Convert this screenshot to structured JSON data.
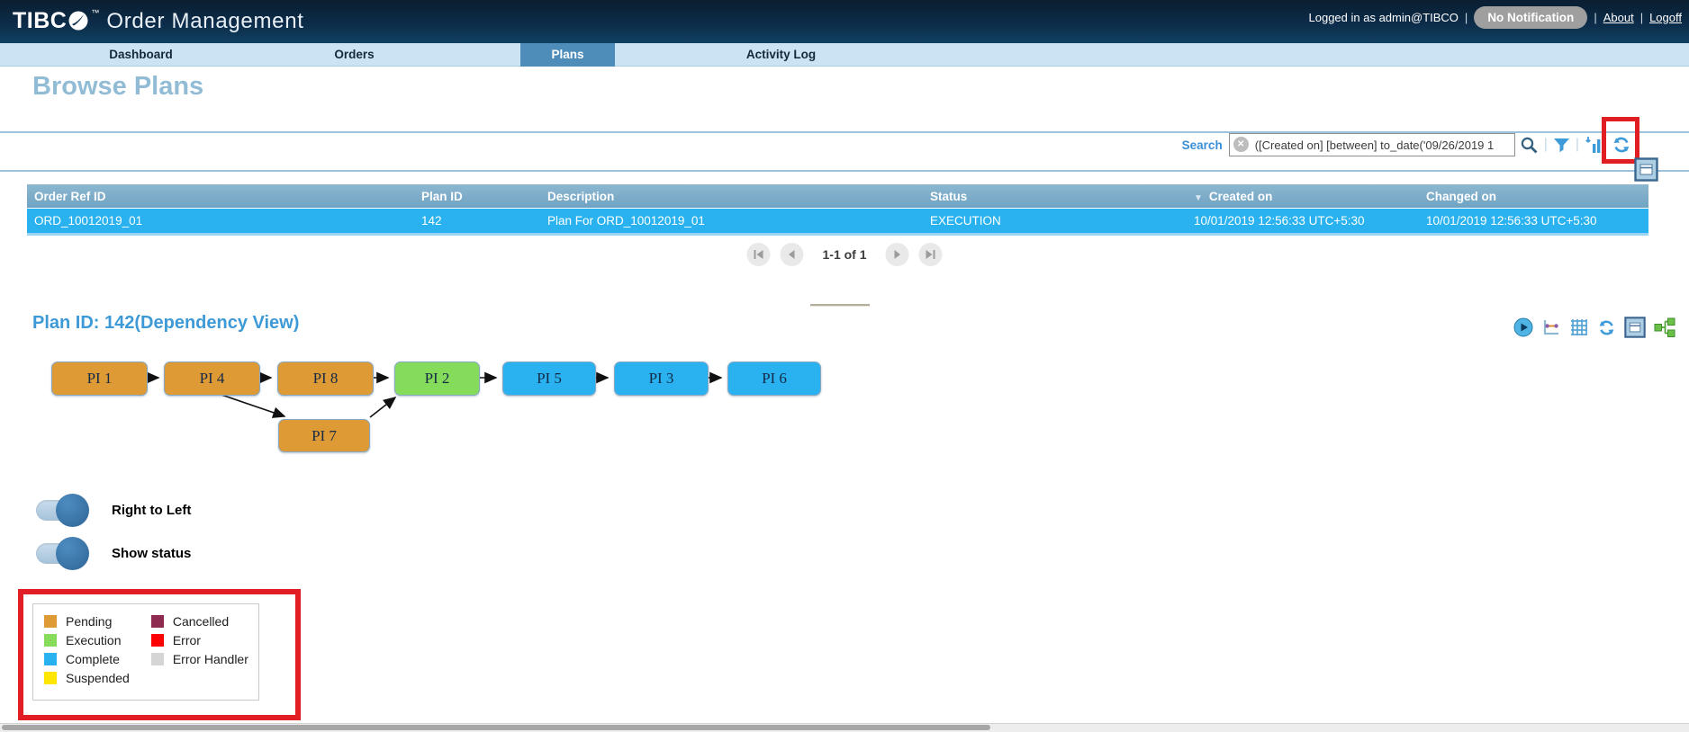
{
  "header": {
    "brand_tibc": "TIBC",
    "brand_tm": "™",
    "brand_product": "Order Management",
    "logged_in_text": "Logged in as admin@TIBCO",
    "divider": "|",
    "notification_label": "No Notification",
    "about_label": "About",
    "logoff_label": "Logoff"
  },
  "nav": {
    "active_tab": "Plans",
    "tabs": [
      {
        "label": "Dashboard"
      },
      {
        "label": "Orders"
      },
      {
        "label": "Plans"
      },
      {
        "label": "Activity Log"
      }
    ]
  },
  "page_title": "Browse Plans",
  "search": {
    "label": "Search",
    "value": "([Created on] [between] to_date('09/26/2019 1",
    "icons": [
      "clear-icon",
      "search-icon",
      "filter-icon",
      "export-report-icon",
      "refresh-icon"
    ]
  },
  "table": {
    "columns": [
      "Order Ref ID",
      "Plan ID",
      "Description",
      "Status",
      "Created on",
      "Changed on"
    ],
    "sorted_column": "Created on",
    "sort_direction": "desc",
    "rows": [
      {
        "order_ref": "ORD_10012019_01",
        "plan_id": "142",
        "description": "Plan For ORD_10012019_01",
        "status": "EXECUTION",
        "created_on": "10/01/2019 12:56:33 UTC+5:30",
        "changed_on": "10/01/2019 12:56:33 UTC+5:30"
      }
    ]
  },
  "pagination": {
    "status": "1-1 of 1"
  },
  "plan_view": {
    "title": "Plan ID: 142(Dependency View)",
    "toolbar_icons": [
      "play-icon",
      "timeline-icon",
      "grid-icon",
      "refresh-icon",
      "panel-icon",
      "tree-view-icon"
    ]
  },
  "graph": {
    "nodes": [
      {
        "label": "PI 1",
        "status": "Pending",
        "color": "#DE9A35"
      },
      {
        "label": "PI 4",
        "status": "Pending",
        "color": "#DE9A35"
      },
      {
        "label": "PI 8",
        "status": "Pending",
        "color": "#DE9A35"
      },
      {
        "label": "PI 2",
        "status": "Execution",
        "color": "#85DC5B"
      },
      {
        "label": "PI 5",
        "status": "Complete",
        "color": "#29B2EF"
      },
      {
        "label": "PI 3",
        "status": "Complete",
        "color": "#29B2EF"
      },
      {
        "label": "PI 6",
        "status": "Complete",
        "color": "#29B2EF"
      },
      {
        "label": "PI 7",
        "status": "Pending",
        "color": "#DE9A35"
      }
    ],
    "edges": [
      [
        "PI 1",
        "PI 4"
      ],
      [
        "PI 4",
        "PI 8"
      ],
      [
        "PI 8",
        "PI 2"
      ],
      [
        "PI 2",
        "PI 5"
      ],
      [
        "PI 5",
        "PI 3"
      ],
      [
        "PI 3",
        "PI 6"
      ],
      [
        "PI 4",
        "PI 7"
      ],
      [
        "PI 7",
        "PI 2"
      ]
    ]
  },
  "toggles": [
    {
      "label": "Right to Left",
      "state": "on"
    },
    {
      "label": "Show status",
      "state": "on"
    }
  ],
  "legend": {
    "column1": [
      {
        "label": "Pending",
        "color": "#DE9A35"
      },
      {
        "label": "Execution",
        "color": "#85DC5B"
      },
      {
        "label": "Complete",
        "color": "#29B2EF"
      },
      {
        "label": "Suspended",
        "color": "#FFE500"
      }
    ],
    "column2": [
      {
        "label": "Cancelled",
        "color": "#8E2A50"
      },
      {
        "label": "Error",
        "color": "#FE0000"
      },
      {
        "label": "Error Handler",
        "color": "#D5D5D5"
      }
    ]
  },
  "annotations": [
    {
      "target": "search-refresh-icon",
      "shape": "red-rectangle"
    },
    {
      "target": "status-legend",
      "shape": "red-rectangle"
    }
  ],
  "colors": {
    "row_blue": "#29B2EF",
    "table_header_blue": "#74A9C8",
    "tab_active_blue": "#4E8DBA",
    "annotation_red": "#E01E23",
    "heading_blue": "#92BCD5",
    "plan_title_blue": "#3E9AD6"
  }
}
